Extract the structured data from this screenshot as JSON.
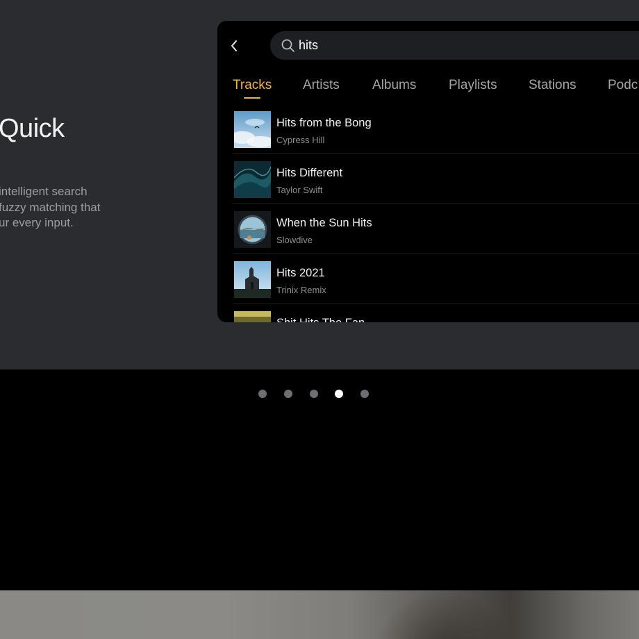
{
  "promo": {
    "title": "Quick",
    "description_lines": [
      "intelligent search",
      "fuzzy matching that",
      "ur every input."
    ]
  },
  "search": {
    "query": "hits"
  },
  "tabs": [
    {
      "label": "Tracks",
      "active": true
    },
    {
      "label": "Artists",
      "active": false
    },
    {
      "label": "Albums",
      "active": false
    },
    {
      "label": "Playlists",
      "active": false
    },
    {
      "label": "Stations",
      "active": false
    },
    {
      "label": "Podc",
      "active": false
    }
  ],
  "tracks": [
    {
      "title": "Hits from the Bong",
      "artist": "Cypress Hill"
    },
    {
      "title": "Hits Different",
      "artist": "Taylor Swift"
    },
    {
      "title": "When the Sun Hits",
      "artist": "Slowdive"
    },
    {
      "title": "Hits 2021",
      "artist": "Trinix Remix"
    },
    {
      "title": "Shit Hits The Fan",
      "artist": ""
    }
  ],
  "pagination": {
    "total": 5,
    "active_index": 3
  },
  "colors": {
    "accent": "#f4b532",
    "panel_bg": "#2b2c30",
    "device_bg": "#000000"
  }
}
